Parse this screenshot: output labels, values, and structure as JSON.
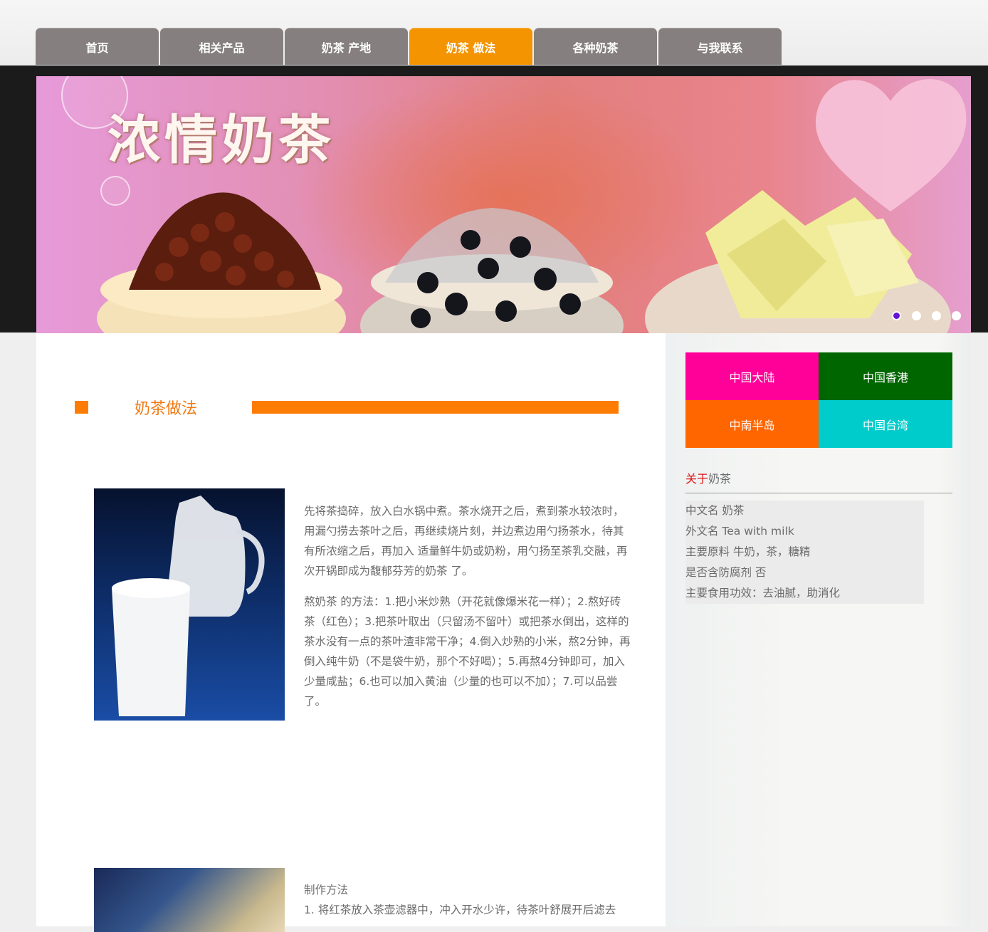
{
  "nav": {
    "tabs": [
      {
        "label": "首页",
        "active": false
      },
      {
        "label": "相关产品",
        "active": false
      },
      {
        "label": "奶茶 产地",
        "active": false
      },
      {
        "label": "奶茶 做法",
        "active": true
      },
      {
        "label": "各种奶茶",
        "active": false
      },
      {
        "label": "与我联系",
        "active": false
      }
    ],
    "active_color": "#f39400",
    "inactive_color": "#867f7f"
  },
  "banner": {
    "title": "浓情奶茶",
    "slide_count": 4,
    "active_slide": 1
  },
  "section": {
    "title": "奶茶做法",
    "accent_color": "#ff7c02"
  },
  "article": {
    "p1": "先将茶捣碎，放入白水锅中煮。茶水烧开之后，煮到茶水较浓时，用漏勺捞去茶叶之后，再继续烧片刻，并边煮边用勺扬茶水，待其有所浓缩之后，再加入 适量鲜牛奶或奶粉，用勺扬至茶乳交融，再次开锅即成为馥郁芬芳的奶茶 了。",
    "p2": "熬奶茶 的方法：1.把小米炒熟（开花就像爆米花一样）；2.熬好砖茶（红色）；3.把茶叶取出（只留汤不留叶）或把茶水倒出，这样的茶水没有一点的茶叶渣非常干净；4.倒入炒熟的小米，熬2分钟，再倒入纯牛奶（不是袋牛奶，那个不好喝）；5.再熬4分钟即可，加入少量咸盐；6.也可以加入黄油（少量的也可以不加）；7.可以品尝了。",
    "p3_title": "制作方法",
    "p3_line1": "1. 将红茶放入茶壶滤器中，冲入开水少许，待茶叶舒展开后滤去"
  },
  "sidebar": {
    "regions": [
      {
        "label": "中国大陆",
        "color": "#ff0099"
      },
      {
        "label": "中国香港",
        "color": "#006600"
      },
      {
        "label": "中南半岛",
        "color": "#ff6600"
      },
      {
        "label": "中国台湾",
        "color": "#00cccc"
      }
    ],
    "about_prefix": "关于",
    "about_suffix": "奶茶",
    "facts": [
      "中文名 奶茶",
      "外文名 Tea with milk",
      "主要原料 牛奶，茶，糖精",
      "是否含防腐剂 否",
      "主要食用功效：去油腻，助消化"
    ]
  }
}
